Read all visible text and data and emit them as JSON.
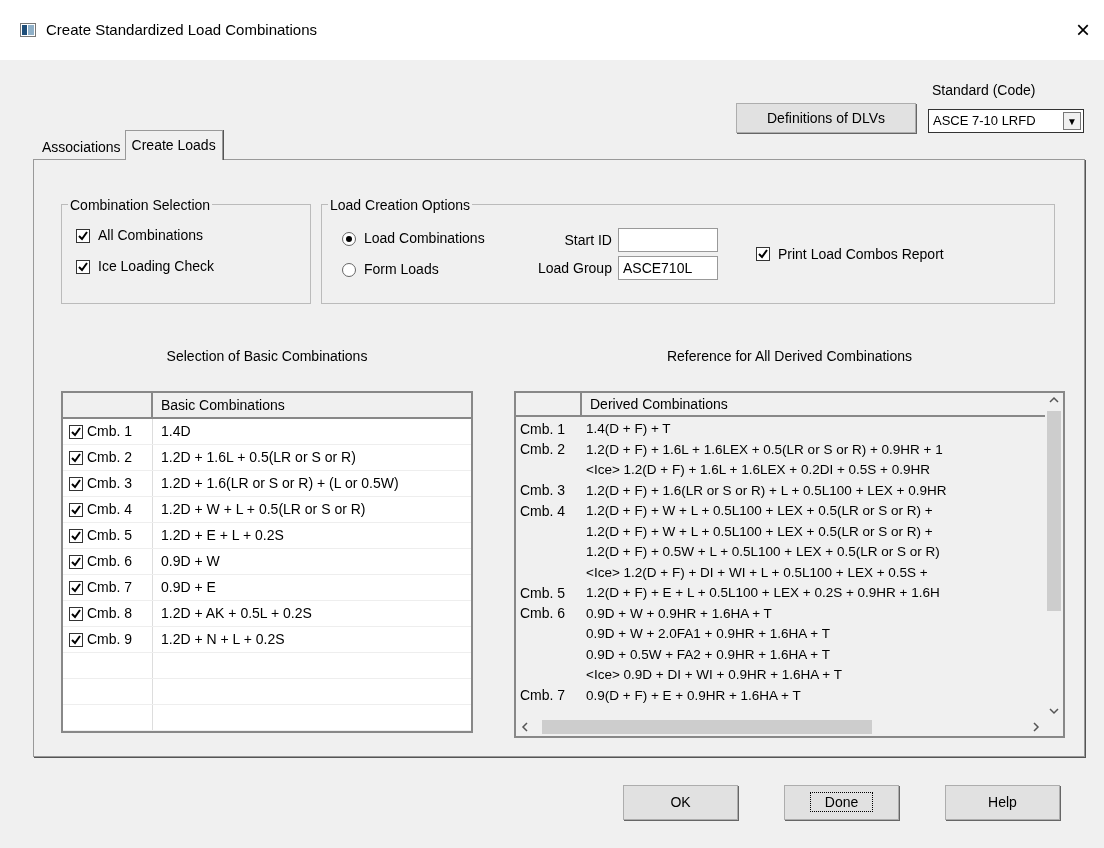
{
  "window": {
    "title": "Create Standardized Load Combinations",
    "close": "×"
  },
  "definitions_button": "Definitions of DLVs",
  "standard": {
    "label": "Standard (Code)",
    "value": "ASCE 7-10 LRFD",
    "arrow": "▼"
  },
  "tabs": [
    {
      "label": "Associations",
      "selected": false
    },
    {
      "label": "Create Loads",
      "selected": true
    }
  ],
  "combination_selection": {
    "title": "Combination Selection",
    "options": [
      {
        "label": "All Combinations",
        "checked": true
      },
      {
        "label": "Ice Loading Check",
        "checked": true
      }
    ]
  },
  "load_creation_options": {
    "title": "Load Creation Options",
    "modes": [
      {
        "label": "Load Combinations",
        "selected": true
      },
      {
        "label": "Form Loads",
        "selected": false
      }
    ],
    "start_id": {
      "label": "Start ID"
    },
    "load_group": {
      "label": "Load Group",
      "value": "ASCE710L"
    },
    "print_report": {
      "label": "Print Load Combos Report",
      "checked": true
    }
  },
  "basic": {
    "title": "Selection of Basic Combinations",
    "column": "Basic Combinations",
    "rows": [
      {
        "label": "Cmb. 1",
        "formula": "1.4D",
        "checked": true
      },
      {
        "label": "Cmb. 2",
        "formula": "1.2D + 1.6L + 0.5(LR or S or R)",
        "checked": true
      },
      {
        "label": "Cmb. 3",
        "formula": "1.2D + 1.6(LR or S or R) + (L or 0.5W)",
        "checked": true
      },
      {
        "label": "Cmb. 4",
        "formula": "1.2D + W + L + 0.5(LR or S or R)",
        "checked": true
      },
      {
        "label": "Cmb. 5",
        "formula": "1.2D + E + L + 0.2S",
        "checked": true
      },
      {
        "label": "Cmb. 6",
        "formula": "0.9D + W",
        "checked": true
      },
      {
        "label": "Cmb. 7",
        "formula": "0.9D + E",
        "checked": true
      },
      {
        "label": "Cmb. 8",
        "formula": "1.2D + AK + 0.5L + 0.2S",
        "checked": true
      },
      {
        "label": "Cmb. 9",
        "formula": "1.2D + N + L + 0.2S",
        "checked": true
      }
    ]
  },
  "derived": {
    "title": "Reference for All Derived Combinations",
    "column": "Derived Combinations",
    "rows": [
      {
        "label": "Cmb. 1",
        "lines": [
          "1.4(D + F) + T"
        ]
      },
      {
        "label": "Cmb. 2",
        "lines": [
          "1.2(D + F) + 1.6L + 1.6LEX + 0.5(LR or S or R) + 0.9HR + 1",
          "<Ice> 1.2(D + F) + 1.6L + 1.6LEX + 0.2DI + 0.5S + 0.9HR"
        ]
      },
      {
        "label": "Cmb. 3",
        "lines": [
          "1.2(D + F) + 1.6(LR or S or R) + L + 0.5L100 + LEX + 0.9HR"
        ]
      },
      {
        "label": "Cmb. 4",
        "lines": [
          "1.2(D + F) + W + L + 0.5L100 + LEX + 0.5(LR or S or R) +",
          "1.2(D + F) + W + L + 0.5L100 + LEX + 0.5(LR or S or R) +",
          "1.2(D + F) + 0.5W + L + 0.5L100 + LEX + 0.5(LR or S or R)",
          "<Ice> 1.2(D + F) + DI + WI + L + 0.5L100 + LEX + 0.5S +"
        ]
      },
      {
        "label": "Cmb. 5",
        "lines": [
          "1.2(D + F) + E + L + 0.5L100 + LEX + 0.2S + 0.9HR + 1.6H"
        ]
      },
      {
        "label": "Cmb. 6",
        "lines": [
          "0.9D + W + 0.9HR + 1.6HA + T",
          "0.9D + W + 2.0FA1 + 0.9HR + 1.6HA + T",
          "0.9D + 0.5W + FA2 + 0.9HR + 1.6HA + T",
          "<Ice> 0.9D + DI + WI + 0.9HR + 1.6HA + T"
        ]
      },
      {
        "label": "Cmb. 7",
        "lines": [
          "0.9(D + F) + E + 0.9HR + 1.6HA + T"
        ]
      }
    ]
  },
  "buttons": [
    {
      "label": "OK",
      "focused": false
    },
    {
      "label": "Done",
      "focused": true
    },
    {
      "label": "Help",
      "focused": false
    }
  ]
}
